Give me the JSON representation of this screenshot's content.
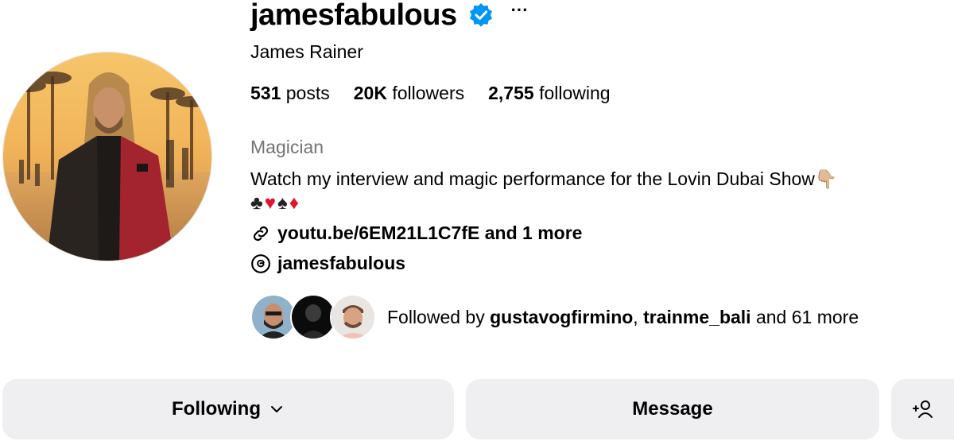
{
  "profile": {
    "username": "jamesfabulous",
    "full_name": "James Rainer",
    "verified": true
  },
  "stats": {
    "posts_count": "531",
    "posts_label": "posts",
    "followers_count": "20K",
    "followers_label": "followers",
    "following_count": "2,755",
    "following_label": "following"
  },
  "bio": {
    "category": "Magician",
    "text": "Watch my interview and magic performance for the Lovin Dubai Show",
    "pointing_emoji": "👇🏼",
    "suits": [
      "♣",
      "♥",
      "♠",
      "♦"
    ]
  },
  "links": {
    "url_text": "youtu.be/6EM21L1C7fE and 1 more",
    "threads_handle": "jamesfabulous"
  },
  "followed_by": {
    "prefix": "Followed by",
    "user1": "gustavogfirmino",
    "separator": ",",
    "user2": "trainme_bali",
    "suffix": "and 61 more"
  },
  "actions": {
    "following_label": "Following",
    "message_label": "Message",
    "add_user_glyph": "+"
  },
  "colors": {
    "verified_blue": "#0095f6",
    "button_bg": "#efeff2",
    "muted_text": "#737373"
  }
}
